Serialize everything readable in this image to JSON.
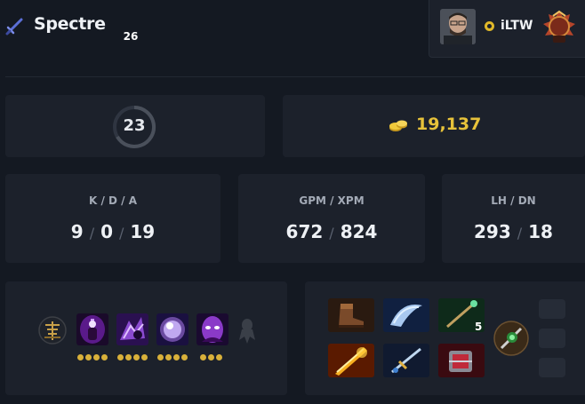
{
  "header": {
    "hero_name": "Spectre",
    "hero_icon": "sword-icon"
  },
  "player": {
    "name": "iLTW",
    "plus_badge": "dota-plus-icon",
    "rank_number": "26",
    "rank_icon": "rank-medal-icon"
  },
  "level": {
    "value": "23"
  },
  "gold": {
    "value": "19,137",
    "icon": "gold-coins-icon"
  },
  "stats": {
    "kda": {
      "label": "K / D / A",
      "kills": "9",
      "deaths": "0",
      "assists": "19"
    },
    "gpm_xpm": {
      "label": "GPM / XPM",
      "gpm": "672",
      "xpm": "824"
    },
    "lh_dn": {
      "label": "LH / DN",
      "last_hits": "293",
      "denies": "18"
    }
  },
  "abilities": {
    "talent_tree_icon": "talent-tree-icon",
    "skills": [
      {
        "name": "spectral-dagger-icon",
        "level": 4
      },
      {
        "name": "desolate-icon",
        "level": 4
      },
      {
        "name": "dispersion-icon",
        "level": 4
      },
      {
        "name": "haunt-icon",
        "level": 3
      }
    ],
    "aghanim_icon": "aghanims-shard-icon"
  },
  "items": {
    "inventory": [
      {
        "name": "boots-icon"
      },
      {
        "name": "diffusal-blade-icon"
      },
      {
        "name": "mystic-staff-icon",
        "charges": "5"
      },
      {
        "name": "radiance-icon"
      },
      {
        "name": "manta-style-icon"
      },
      {
        "name": "blade-mail-icon"
      }
    ],
    "neutral_item": "neutral-item-icon"
  },
  "colors": {
    "background": "#141922",
    "card": "#1c212b",
    "gold": "#e7c23a",
    "dot": "#d9b13a"
  }
}
